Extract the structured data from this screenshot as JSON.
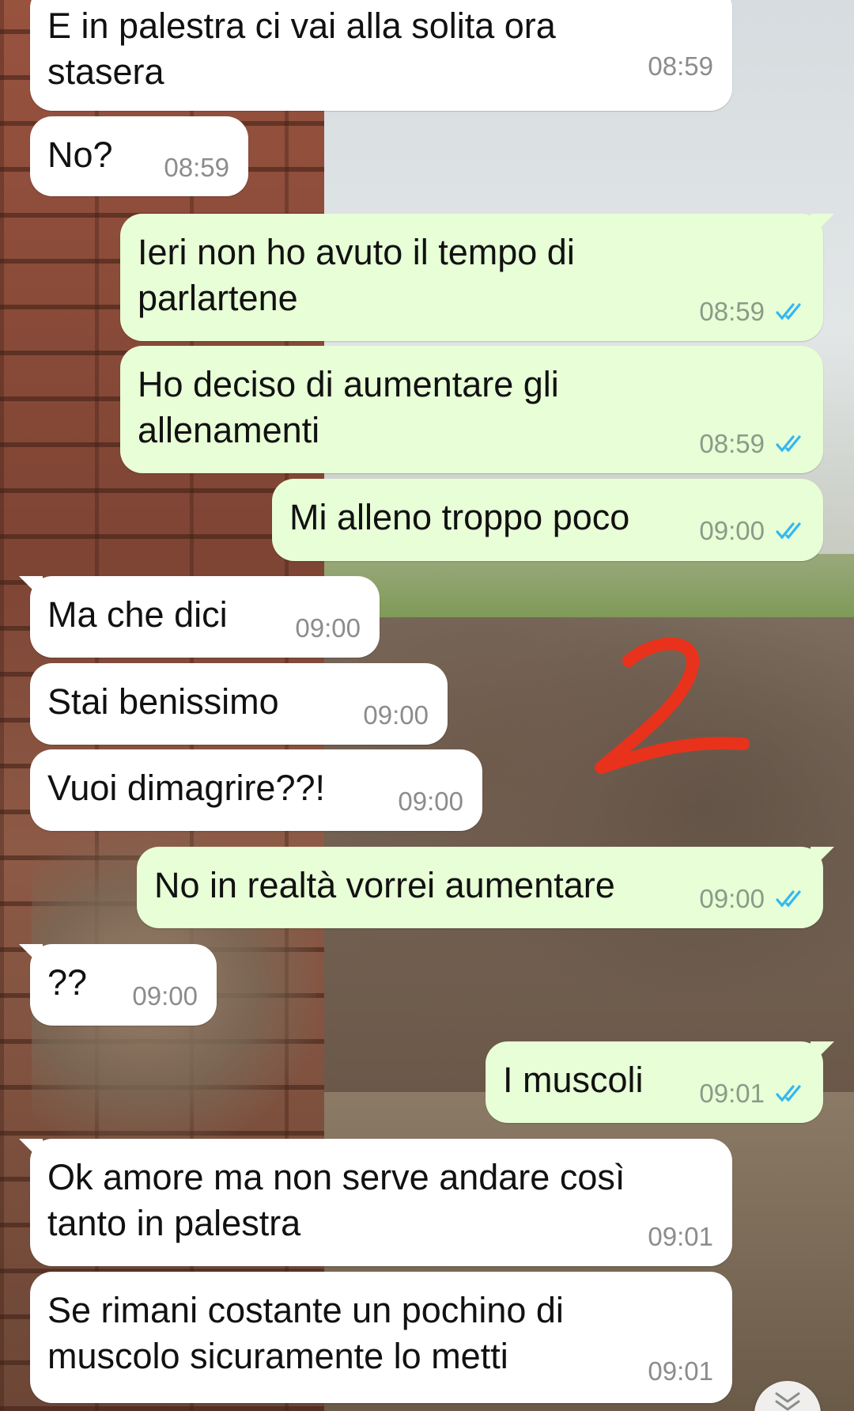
{
  "colors": {
    "incoming_bubble": "#ffffff",
    "outgoing_bubble": "#e7fed6",
    "read_ticks": "#34b7f1",
    "text": "#111111",
    "timestamp": "#8c8c8c"
  },
  "messages": [
    {
      "direction": "in",
      "text": "E in palestra ci vai alla solita ora\nstasera",
      "time": "08:59"
    },
    {
      "direction": "in",
      "text": "No?",
      "time": "08:59"
    },
    {
      "direction": "out",
      "text": "Ieri non ho avuto il tempo di\nparlartene",
      "time": "08:59",
      "status": "read"
    },
    {
      "direction": "out",
      "text": "Ho deciso di aumentare gli\nallenamenti",
      "time": "08:59",
      "status": "read"
    },
    {
      "direction": "out",
      "text": "Mi alleno troppo poco",
      "time": "09:00",
      "status": "read"
    },
    {
      "direction": "in",
      "text": "Ma che dici",
      "time": "09:00"
    },
    {
      "direction": "in",
      "text": "Stai benissimo",
      "time": "09:00"
    },
    {
      "direction": "in",
      "text": "Vuoi dimagrire??!",
      "time": "09:00"
    },
    {
      "direction": "out",
      "text": "No in realtà vorrei aumentare",
      "time": "09:00",
      "status": "read"
    },
    {
      "direction": "in",
      "text": "??",
      "time": "09:00"
    },
    {
      "direction": "out",
      "text": "I muscoli",
      "time": "09:01",
      "status": "read"
    },
    {
      "direction": "in",
      "text": "Ok amore ma non serve andare così\ntanto in palestra",
      "time": "09:01"
    },
    {
      "direction": "in",
      "text": "Se rimani costante un pochino di\nmuscolo sicuramente lo metti",
      "time": "09:01"
    }
  ],
  "icons": {
    "read_ticks": "double-check-icon",
    "scroll_down": "double-chevron-down-icon"
  }
}
